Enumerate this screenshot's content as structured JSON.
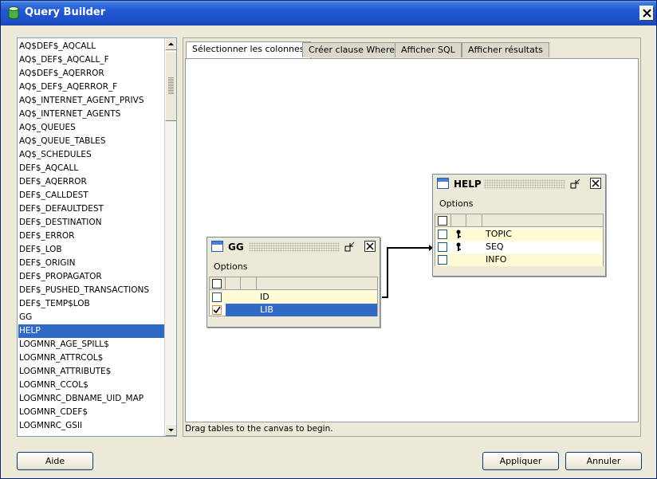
{
  "window": {
    "title": "Query Builder",
    "close_symbol": "X"
  },
  "table_list": {
    "items": [
      "AQ$DEF$_AQCALL",
      "AQ$_DEF$_AQCALL_F",
      "AQ$DEF$_AQERROR",
      "AQ$_DEF$_AQERROR_F",
      "AQ$_INTERNET_AGENT_PRIVS",
      "AQ$_INTERNET_AGENTS",
      "AQ$_QUEUES",
      "AQ$_QUEUE_TABLES",
      "AQ$_SCHEDULES",
      "DEF$_AQCALL",
      "DEF$_AQERROR",
      "DEF$_CALLDEST",
      "DEF$_DEFAULTDEST",
      "DEF$_DESTINATION",
      "DEF$_ERROR",
      "DEF$_LOB",
      "DEF$_ORIGIN",
      "DEF$_PROPAGATOR",
      "DEF$_PUSHED_TRANSACTIONS",
      "DEF$_TEMP$LOB",
      "GG",
      "HELP",
      "LOGMNR_AGE_SPILL$",
      "LOGMNR_ATTRCOL$",
      "LOGMNR_ATTRIBUTE$",
      "LOGMNR_CCOL$",
      "LOGMNRC_DBNAME_UID_MAP",
      "LOGMNR_CDEF$",
      "LOGMNRC_GSII"
    ],
    "selected": "HELP"
  },
  "tabs": [
    {
      "label": "Sélectionner les colonnes",
      "active": true
    },
    {
      "label": "Créer clause Where",
      "active": false
    },
    {
      "label": "Afficher SQL",
      "active": false
    },
    {
      "label": "Afficher résultats",
      "active": false
    }
  ],
  "status": "Drag tables to the canvas to begin.",
  "tables": {
    "gg": {
      "name": "GG",
      "options_label": "Options",
      "columns": [
        {
          "name": "ID",
          "checked": false,
          "key": false,
          "selected": false
        },
        {
          "name": "LIB",
          "checked": true,
          "key": false,
          "selected": true
        }
      ]
    },
    "help": {
      "name": "HELP",
      "options_label": "Options",
      "columns": [
        {
          "name": "TOPIC",
          "checked": false,
          "key": true
        },
        {
          "name": "SEQ",
          "checked": false,
          "key": true
        },
        {
          "name": "INFO",
          "checked": false,
          "key": false
        }
      ]
    }
  },
  "buttons": {
    "help": "Aide",
    "apply": "Appliquer",
    "cancel": "Annuler"
  },
  "colors": {
    "title_bar": "#2258d3",
    "selection": "#316ac5",
    "row_highlight": "#fffcd5"
  }
}
